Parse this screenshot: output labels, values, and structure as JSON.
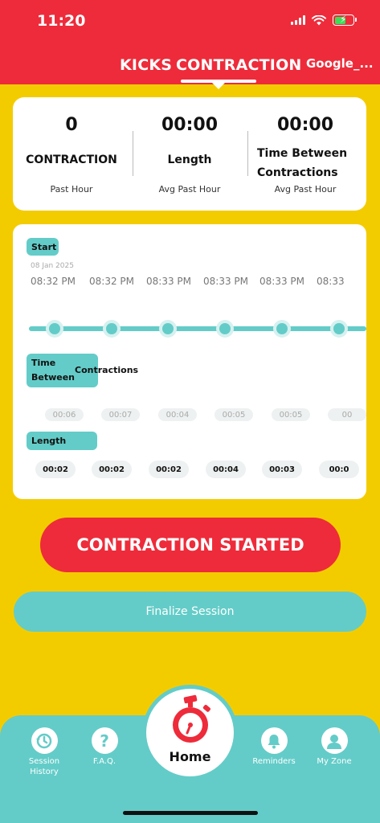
{
  "status_bar": {
    "time": "11:20"
  },
  "header": {
    "tabs": [
      {
        "label": "KICKS",
        "active": false
      },
      {
        "label": "CONTRACTION",
        "active": true
      }
    ],
    "profile_name": "Google_..."
  },
  "stats": [
    {
      "value": "0",
      "label": "CONTRACTION",
      "sub": "Past Hour"
    },
    {
      "value": "00:00",
      "label": "Length",
      "sub": "Avg Past Hour"
    },
    {
      "value": "00:00",
      "label_line1": "Time Between",
      "label_line2": "Contractions",
      "sub": "Avg Past Hour"
    }
  ],
  "timeline": {
    "start_label": "Start",
    "date": "08 Jan 2025",
    "times": [
      "08:32 PM",
      "08:32 PM",
      "08:33 PM",
      "08:33 PM",
      "08:33 PM",
      "08:33"
    ],
    "between_label_line1": "Time Between",
    "between_label_line2": "Contractions",
    "between_values": [
      "00:06",
      "00:07",
      "00:04",
      "00:05",
      "00:05",
      "00"
    ],
    "length_label": "Length",
    "length_values": [
      "00:02",
      "00:02",
      "00:02",
      "00:04",
      "00:03",
      "00:0"
    ]
  },
  "buttons": {
    "contraction_started": "CONTRACTION STARTED",
    "finalize": "Finalize Session"
  },
  "bottom_nav": {
    "session_history_line1": "Session",
    "session_history_line2": "History",
    "faq": "F.A.Q.",
    "home": "Home",
    "reminders": "Reminders",
    "my_zone": "My Zone"
  },
  "colors": {
    "red": "#EE2B3A",
    "yellow": "#F3CC00",
    "teal": "#63CCC8",
    "white": "#FFFFFF"
  },
  "icons": [
    "wifi-icon",
    "battery-charging-icon",
    "signal-icon",
    "history-icon",
    "question-icon",
    "stopwatch-icon",
    "bell-icon",
    "user-icon"
  ]
}
